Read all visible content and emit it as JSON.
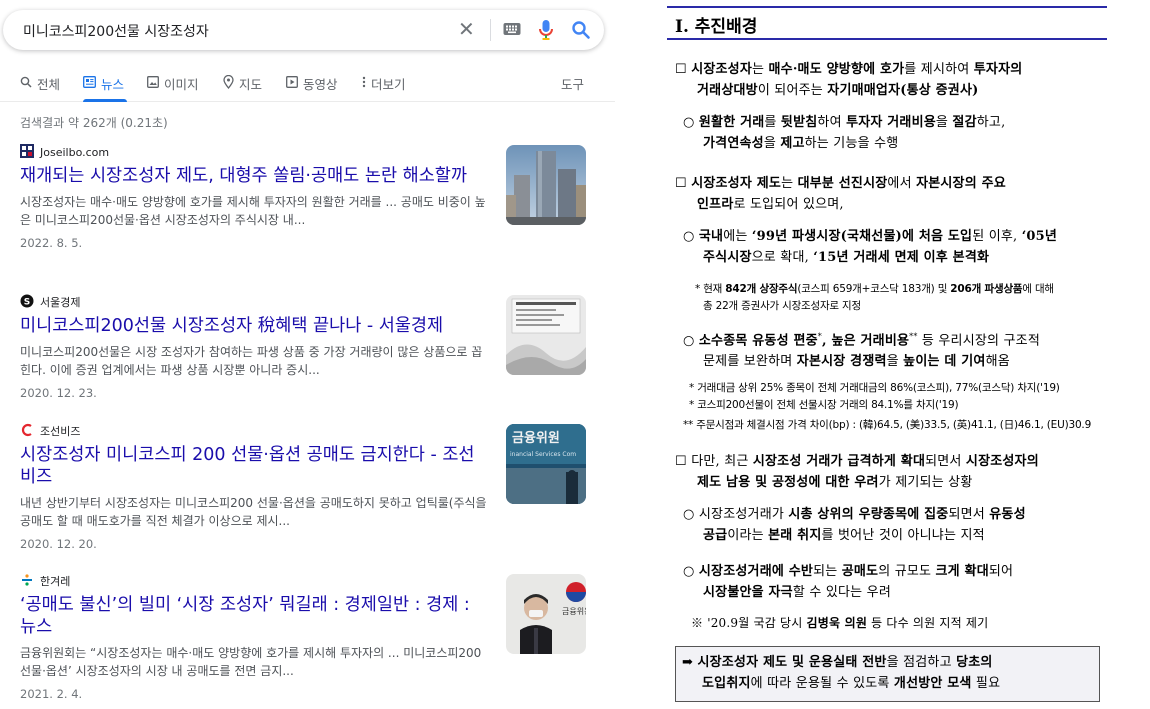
{
  "search": {
    "query": "미니코스피200선물 시장조성자",
    "stats": "검색결과 약 262개 (0.21초)"
  },
  "tabs": [
    {
      "label": "전체"
    },
    {
      "label": "뉴스"
    },
    {
      "label": "이미지"
    },
    {
      "label": "지도"
    },
    {
      "label": "동영상"
    },
    {
      "label": "더보기"
    },
    {
      "label": "도구"
    }
  ],
  "results": [
    {
      "source": "Joseilbo.com",
      "title": "재개되는 시장조성자 제도, 대형주 쏠림·공매도 논란 해소할까",
      "snippet": "시장조성자는 매수·매도 양방향에 호가를 제시해 투자자의 원활한 거래를 ... 공매도 비중이 높은 미니코스피200선물·옵션 시장조성자의 주식시장 내...",
      "date": "2022. 8. 5."
    },
    {
      "source": "서울경제",
      "title": "미니코스피200선물 시장조성자 稅혜택 끝나나 - 서울경제",
      "snippet": "미니코스피200선물은 시장 조성자가 참여하는 파생 상품 중 가장 거래량이 많은 상품으로 꼽힌다. 이에 증권 업계에서는 파생 상품 시장뿐 아니라 증시...",
      "date": "2020. 12. 23."
    },
    {
      "source": "조선비즈",
      "title": "시장조성자 미니코스피 200 선물·옵션 공매도 금지한다 - 조선비즈",
      "snippet": "내년 상반기부터 시장조성자는 미니코스피200 선물·옵션을 공매도하지 못하고 업틱룰(주식을 공매도 할 때 매도호가를 직전 체결가 이상으로 제시...",
      "date": "2020. 12. 20."
    },
    {
      "source": "한겨레",
      "title": "‘공매도 불신’의 빌미 ‘시장 조성자’ 뭐길래 : 경제일반 : 경제 : 뉴스",
      "snippet": "금융위원회는 “시장조성자는 매수·매도 양방향에 호가를 제시해 투자자의 ... 미니코스피200 선물·옵션’ 시장조성자의 시장 내 공매도를 전면 금지...",
      "date": "2021. 2. 4."
    }
  ],
  "thumbs": {
    "t3_text": "금융위원",
    "t3_sub": "inancial Services Com",
    "t4_text": "금융위원"
  },
  "doc": {
    "heading": "Ⅰ. 추진배경",
    "box_marker": "☐",
    "circle_marker": "○",
    "arrow_marker": "➡",
    "p1a": "시장조성자",
    "p1b": "는 ",
    "p1c": "매수·매도 양방향에 호가",
    "p1d": "를 제시하여 ",
    "p1e": "투자자의",
    "p1f": "거래상대방",
    "p1g": "이 되어주는 ",
    "p1h": "자기매매업자(통상 증권사)",
    "p2a": "원활한 거래",
    "p2b": "를 ",
    "p2c": "뒷받침",
    "p2d": "하여 ",
    "p2e": "투자자 거래비용",
    "p2f": "을 ",
    "p2g": "절감",
    "p2h": "하고,",
    "p2i": "가격연속성",
    "p2j": "을 ",
    "p2k": "제고",
    "p2l": "하는 기능을 수행",
    "p3a": "시장조성자 제도",
    "p3b": "는 ",
    "p3c": "대부분 선진시장",
    "p3d": "에서 ",
    "p3e": "자본시장의 주요",
    "p3f": "인프라",
    "p3g": "로 도입되어 있으며,",
    "p4a": "국내",
    "p4b": "에는 ",
    "p4c": "‘99년 파생시장(국채선물)에 처음 도입",
    "p4d": "된 이후, ",
    "p4e": "‘05년",
    "p4f": "주식시장",
    "p4g": "으로 확대, ",
    "p4h": "‘15년 거래세 면제 이후 본격화",
    "n1a": "* 현재 ",
    "n1b": "842개 상장주식",
    "n1c": "(코스피 659개+코스닥 183개) 및 ",
    "n1d": "206개 파생상품",
    "n1e": "에 대해",
    "n1f": "총 22개 증권사가 시장조성자로 지정",
    "p5a": "소수종목 유동성 편중",
    "p5b": "*",
    "p5c": ", ",
    "p5d": "높은 거래비용",
    "p5e": "**",
    "p5f": " 등 우리시장의 구조적",
    "p5g": "문제를 보완하며 ",
    "p5h": "자본시장 경쟁력",
    "p5i": "을 ",
    "p5j": "높이는 데 기여",
    "p5k": "해옴",
    "n2": "* 거래대금 상위 25% 종목이 전체 거래대금의 86%(코스피), 77%(코스닥) 차지('19)",
    "n3": "* 코스피200선물이 전체 선물시장 거래의 84.1%를 차지('19)",
    "n4": "** 주문시점과 체결시점 가격 차이(bp) : (韓)64.5, (美)33.5, (英)41.1, (日)46.1, (EU)30.9",
    "p6a": "다만, 최근 ",
    "p6b": "시장조성 거래가 급격하게 확대",
    "p6c": "되면서 ",
    "p6d": "시장조성자의",
    "p6e": "제도 남용 및 공정성에 대한 우려",
    "p6f": "가 제기되는 상황",
    "p7a": "시장조성거래가 ",
    "p7b": "시총 상위의 우량종목에 집중",
    "p7c": "되면서 ",
    "p7d": "유동성",
    "p7e": "공급",
    "p7f": "이라는 ",
    "p7g": "본래 취지",
    "p7h": "를 벗어난 것이 아니냐는 지적",
    "p8a": "시장조성거래에 수반",
    "p8b": "되는 ",
    "p8c": "공매도",
    "p8d": "의 규모도 ",
    "p8e": "크게 확대",
    "p8f": "되어",
    "p8g": "시장불안을 자극",
    "p8h": "할 수 있다는 우려",
    "n5a": "※ '20.9월 국감 당시 ",
    "n5b": "김병욱 의원",
    "n5c": " 등 다수 의원 지적 제기",
    "b1a": "시장조성자 제도 및 운용실태 전반",
    "b1b": "을 점검하고 ",
    "b1c": "당초의",
    "b1d": "도입취지",
    "b1e": "에 따라 운용될 수 있도록 ",
    "b1f": "개선방안 모색",
    "b1g": " 필요"
  }
}
